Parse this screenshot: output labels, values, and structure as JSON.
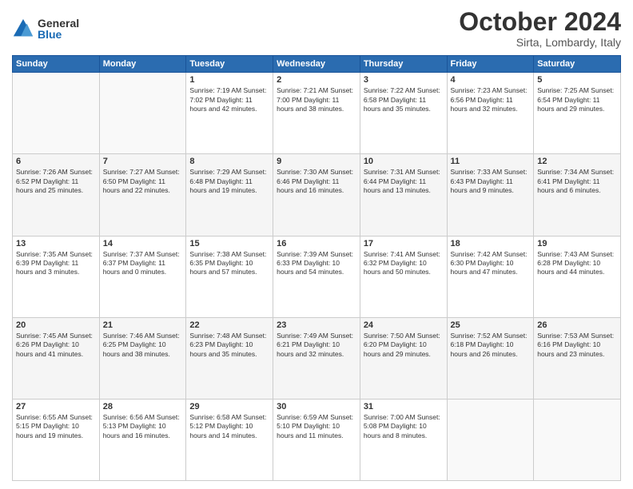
{
  "logo": {
    "general": "General",
    "blue": "Blue"
  },
  "title": "October 2024",
  "location": "Sirta, Lombardy, Italy",
  "header_days": [
    "Sunday",
    "Monday",
    "Tuesday",
    "Wednesday",
    "Thursday",
    "Friday",
    "Saturday"
  ],
  "weeks": [
    [
      {
        "day": "",
        "info": ""
      },
      {
        "day": "",
        "info": ""
      },
      {
        "day": "1",
        "info": "Sunrise: 7:19 AM\nSunset: 7:02 PM\nDaylight: 11 hours and 42 minutes."
      },
      {
        "day": "2",
        "info": "Sunrise: 7:21 AM\nSunset: 7:00 PM\nDaylight: 11 hours and 38 minutes."
      },
      {
        "day": "3",
        "info": "Sunrise: 7:22 AM\nSunset: 6:58 PM\nDaylight: 11 hours and 35 minutes."
      },
      {
        "day": "4",
        "info": "Sunrise: 7:23 AM\nSunset: 6:56 PM\nDaylight: 11 hours and 32 minutes."
      },
      {
        "day": "5",
        "info": "Sunrise: 7:25 AM\nSunset: 6:54 PM\nDaylight: 11 hours and 29 minutes."
      }
    ],
    [
      {
        "day": "6",
        "info": "Sunrise: 7:26 AM\nSunset: 6:52 PM\nDaylight: 11 hours and 25 minutes."
      },
      {
        "day": "7",
        "info": "Sunrise: 7:27 AM\nSunset: 6:50 PM\nDaylight: 11 hours and 22 minutes."
      },
      {
        "day": "8",
        "info": "Sunrise: 7:29 AM\nSunset: 6:48 PM\nDaylight: 11 hours and 19 minutes."
      },
      {
        "day": "9",
        "info": "Sunrise: 7:30 AM\nSunset: 6:46 PM\nDaylight: 11 hours and 16 minutes."
      },
      {
        "day": "10",
        "info": "Sunrise: 7:31 AM\nSunset: 6:44 PM\nDaylight: 11 hours and 13 minutes."
      },
      {
        "day": "11",
        "info": "Sunrise: 7:33 AM\nSunset: 6:43 PM\nDaylight: 11 hours and 9 minutes."
      },
      {
        "day": "12",
        "info": "Sunrise: 7:34 AM\nSunset: 6:41 PM\nDaylight: 11 hours and 6 minutes."
      }
    ],
    [
      {
        "day": "13",
        "info": "Sunrise: 7:35 AM\nSunset: 6:39 PM\nDaylight: 11 hours and 3 minutes."
      },
      {
        "day": "14",
        "info": "Sunrise: 7:37 AM\nSunset: 6:37 PM\nDaylight: 11 hours and 0 minutes."
      },
      {
        "day": "15",
        "info": "Sunrise: 7:38 AM\nSunset: 6:35 PM\nDaylight: 10 hours and 57 minutes."
      },
      {
        "day": "16",
        "info": "Sunrise: 7:39 AM\nSunset: 6:33 PM\nDaylight: 10 hours and 54 minutes."
      },
      {
        "day": "17",
        "info": "Sunrise: 7:41 AM\nSunset: 6:32 PM\nDaylight: 10 hours and 50 minutes."
      },
      {
        "day": "18",
        "info": "Sunrise: 7:42 AM\nSunset: 6:30 PM\nDaylight: 10 hours and 47 minutes."
      },
      {
        "day": "19",
        "info": "Sunrise: 7:43 AM\nSunset: 6:28 PM\nDaylight: 10 hours and 44 minutes."
      }
    ],
    [
      {
        "day": "20",
        "info": "Sunrise: 7:45 AM\nSunset: 6:26 PM\nDaylight: 10 hours and 41 minutes."
      },
      {
        "day": "21",
        "info": "Sunrise: 7:46 AM\nSunset: 6:25 PM\nDaylight: 10 hours and 38 minutes."
      },
      {
        "day": "22",
        "info": "Sunrise: 7:48 AM\nSunset: 6:23 PM\nDaylight: 10 hours and 35 minutes."
      },
      {
        "day": "23",
        "info": "Sunrise: 7:49 AM\nSunset: 6:21 PM\nDaylight: 10 hours and 32 minutes."
      },
      {
        "day": "24",
        "info": "Sunrise: 7:50 AM\nSunset: 6:20 PM\nDaylight: 10 hours and 29 minutes."
      },
      {
        "day": "25",
        "info": "Sunrise: 7:52 AM\nSunset: 6:18 PM\nDaylight: 10 hours and 26 minutes."
      },
      {
        "day": "26",
        "info": "Sunrise: 7:53 AM\nSunset: 6:16 PM\nDaylight: 10 hours and 23 minutes."
      }
    ],
    [
      {
        "day": "27",
        "info": "Sunrise: 6:55 AM\nSunset: 5:15 PM\nDaylight: 10 hours and 19 minutes."
      },
      {
        "day": "28",
        "info": "Sunrise: 6:56 AM\nSunset: 5:13 PM\nDaylight: 10 hours and 16 minutes."
      },
      {
        "day": "29",
        "info": "Sunrise: 6:58 AM\nSunset: 5:12 PM\nDaylight: 10 hours and 14 minutes."
      },
      {
        "day": "30",
        "info": "Sunrise: 6:59 AM\nSunset: 5:10 PM\nDaylight: 10 hours and 11 minutes."
      },
      {
        "day": "31",
        "info": "Sunrise: 7:00 AM\nSunset: 5:08 PM\nDaylight: 10 hours and 8 minutes."
      },
      {
        "day": "",
        "info": ""
      },
      {
        "day": "",
        "info": ""
      }
    ]
  ]
}
